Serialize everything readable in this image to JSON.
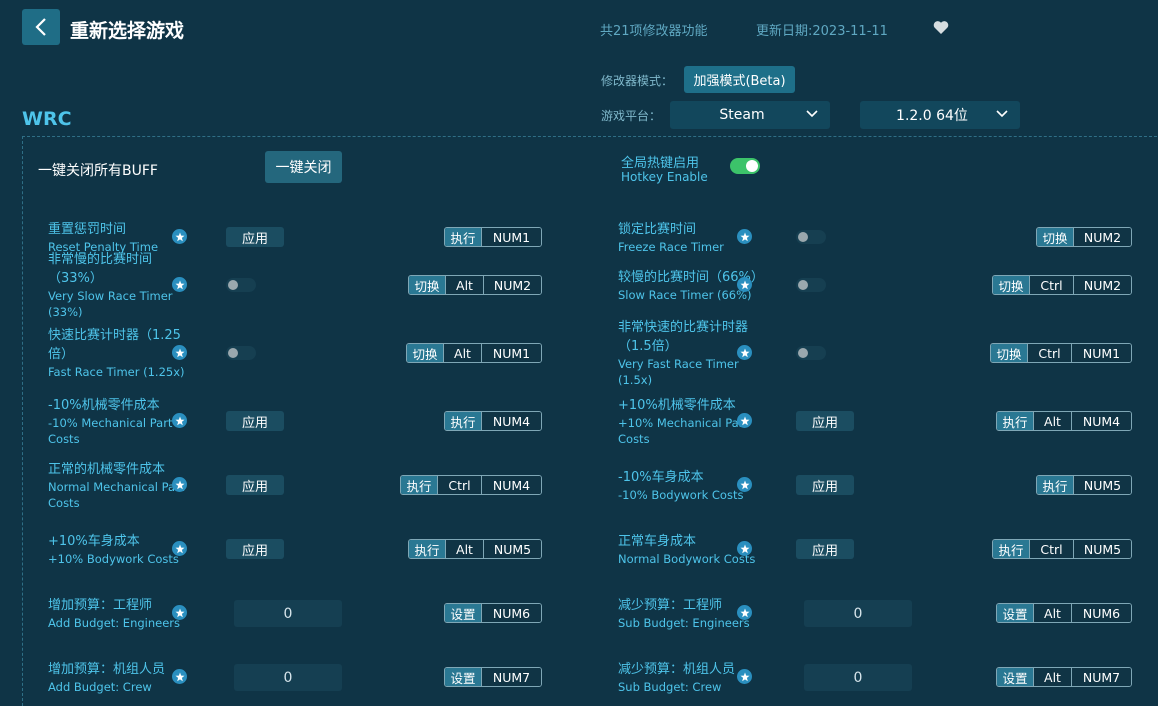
{
  "header": {
    "back_icon": "chevron-left-icon",
    "title": "重新选择游戏",
    "feature_count": "共21项修改器功能",
    "update_date": "更新日期:2023-11-11",
    "favorite_icon": "heart-icon"
  },
  "mode": {
    "label": "修改器模式：",
    "value": "加强模式(Beta)"
  },
  "platform": {
    "label": "游戏平台：",
    "platform_value": "Steam",
    "version_value": "1.2.0 64位"
  },
  "game": {
    "name": "WRC"
  },
  "master": {
    "close_all_label": "一键关闭所有BUFF",
    "close_all_button": "一键关闭",
    "hotkey_cn": "全局热键启用",
    "hotkey_en": "Hotkey Enable",
    "hotkey_enabled": true
  },
  "colors": {
    "accent": "#4ec4ea",
    "background": "#0f3446",
    "toggle_on": "#3cc36a"
  },
  "options": [
    {
      "cn": "重置惩罚时间",
      "en": "Reset Penalty Time",
      "control": "应用",
      "keys": [
        "执行",
        "NUM1"
      ]
    },
    {
      "cn": "锁定比赛时间",
      "en": "Freeze Race Timer",
      "control": "toggle-off",
      "keys": [
        "切换",
        "NUM2"
      ]
    },
    {
      "cn": "非常慢的比赛时间（33%）",
      "en": "Very Slow Race Timer (33%)",
      "control": "toggle-off",
      "keys": [
        "切换",
        "Alt",
        "NUM2"
      ]
    },
    {
      "cn": "较慢的比赛时间（66%）",
      "en": "Slow Race Timer (66%)",
      "control": "toggle-off",
      "keys": [
        "切换",
        "Ctrl",
        "NUM2"
      ]
    },
    {
      "cn": "快速比赛计时器（1.25倍）",
      "en": "Fast Race Timer (1.25x)",
      "control": "toggle-off",
      "keys": [
        "切换",
        "Alt",
        "NUM1"
      ]
    },
    {
      "cn": "非常快速的比赛计时器（1.5倍）",
      "en": "Very Fast Race Timer (1.5x)",
      "control": "toggle-off",
      "keys": [
        "切换",
        "Ctrl",
        "NUM1"
      ]
    },
    {
      "cn": "-10%机械零件成本",
      "en": "-10% Mechanical Part Costs",
      "control": "应用",
      "keys": [
        "执行",
        "NUM4"
      ]
    },
    {
      "cn": "+10%机械零件成本",
      "en": "+10% Mechanical Part Costs",
      "control": "应用",
      "keys": [
        "执行",
        "Alt",
        "NUM4"
      ]
    },
    {
      "cn": "正常的机械零件成本",
      "en": "Normal Mechanical Part Costs",
      "control": "应用",
      "keys": [
        "执行",
        "Ctrl",
        "NUM4"
      ]
    },
    {
      "cn": "-10%车身成本",
      "en": "-10% Bodywork Costs",
      "control": "应用",
      "keys": [
        "执行",
        "NUM5"
      ]
    },
    {
      "cn": "+10%车身成本",
      "en": "+10% Bodywork Costs",
      "control": "应用",
      "keys": [
        "执行",
        "Alt",
        "NUM5"
      ]
    },
    {
      "cn": "正常车身成本",
      "en": "Normal Bodywork Costs",
      "control": "应用",
      "keys": [
        "执行",
        "Ctrl",
        "NUM5"
      ]
    },
    {
      "cn": "增加预算：工程师",
      "en": "Add Budget: Engineers",
      "control": "0",
      "keys": [
        "设置",
        "NUM6"
      ]
    },
    {
      "cn": "减少预算：工程师",
      "en": "Sub Budget: Engineers",
      "control": "0",
      "keys": [
        "设置",
        "Alt",
        "NUM6"
      ]
    },
    {
      "cn": "增加预算：机组人员",
      "en": "Add Budget: Crew",
      "control": "0",
      "keys": [
        "设置",
        "NUM7"
      ]
    },
    {
      "cn": "减少预算：机组人员",
      "en": "Sub Budget: Crew",
      "control": "0",
      "keys": [
        "设置",
        "Alt",
        "NUM7"
      ]
    }
  ]
}
